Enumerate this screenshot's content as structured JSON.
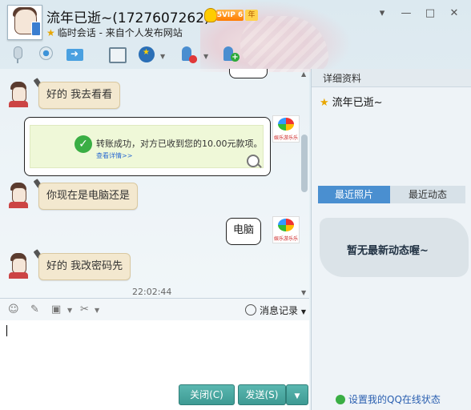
{
  "header": {
    "contact_name": "流年已逝~(1727607262)",
    "vip_label": "5VIP 6",
    "year_label": "年",
    "session_text": "临时会话 - 来自个人发布网站",
    "window_controls": [
      "▾",
      "—",
      "□",
      "✕"
    ]
  },
  "toolbar": {
    "icons": [
      "microphone-icon",
      "video-camera-icon",
      "send-file-icon",
      "remote-screen-icon",
      "group-icon",
      "remove-contact-icon",
      "add-contact-icon"
    ]
  },
  "chat": {
    "messages": [
      {
        "side": "left",
        "text": "好的 我去看看"
      },
      {
        "side": "right",
        "type": "transfer",
        "text": "转账成功，对方已收到您的10.00元款项。",
        "link": "查看详情>>"
      },
      {
        "side": "left",
        "text": "你现在是电脑还是"
      },
      {
        "side": "right",
        "text": "电脑"
      },
      {
        "side": "left",
        "text": "好的 我改密码先"
      }
    ],
    "timestamp": "22:02:44",
    "logo_text": "娱乐游乐乐"
  },
  "input": {
    "history_label": "消息记录",
    "close_label": "关闭(C)",
    "send_label": "发送(S)"
  },
  "sidebar": {
    "header": "详细资料",
    "name": "流年已逝~",
    "tabs": [
      "最近照片",
      "最近动态"
    ],
    "empty_text": "暂无最新动态喔~",
    "status_link": "设置我的QQ在线状态"
  }
}
